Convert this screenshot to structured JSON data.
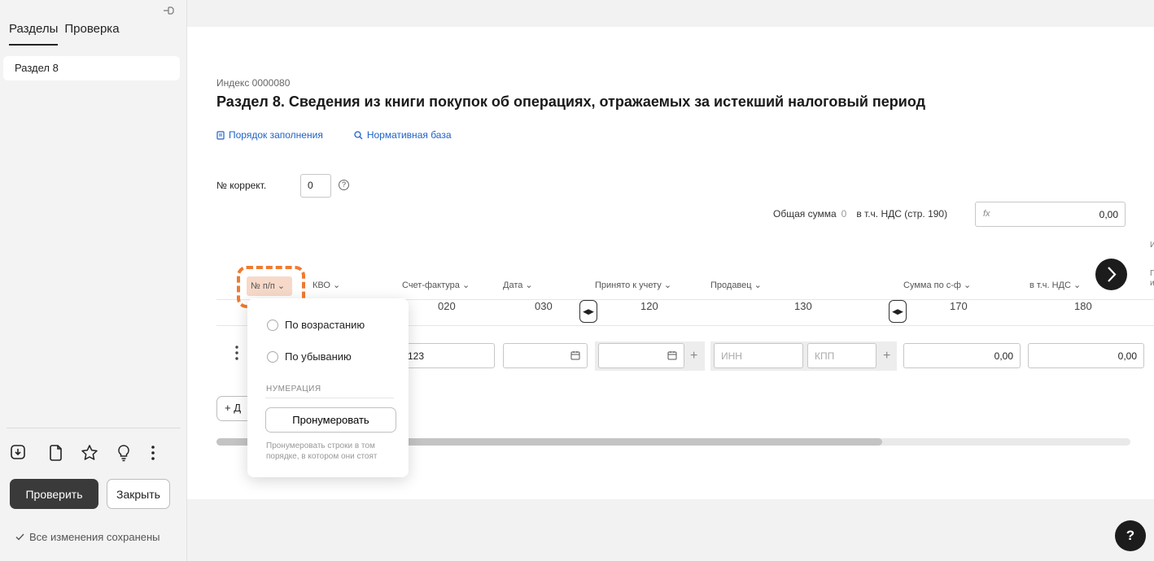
{
  "sidebar": {
    "tabs": [
      "Разделы",
      "Проверка"
    ],
    "items": [
      {
        "label": "Раздел 8"
      }
    ],
    "check_label": "Проверить",
    "close_label": "Закрыть",
    "saved_text": "Все изменения сохранены"
  },
  "header": {
    "index": "Индекс 0000080",
    "title": "Раздел 8. Сведения из книги покупок об операциях, отражаемых за истекший налоговый период",
    "link_order": "Порядок заполнения",
    "link_base": "Нормативная база"
  },
  "form": {
    "korr_label": "№ коррект.",
    "korr_value": "0",
    "total_label": "Общая сумма",
    "total_count": "0",
    "vat_label": "в т.ч. НДС (стр. 190)",
    "vat_value": "0,00",
    "fx": "fx"
  },
  "table": {
    "headers": {
      "num": "№ п/п ⌄",
      "kvo": "КВО ⌄",
      "invoice": "Счет-фактура ⌄",
      "date": "Дата ⌄",
      "accepted": "Принято к учету ⌄",
      "seller": "Продавец ⌄",
      "sum": "Сумма по с-ф ⌄",
      "vat": "в т.ч. НДС ⌄"
    },
    "codes": [
      "020",
      "030",
      "120",
      "130",
      "170",
      "180"
    ],
    "row": {
      "invoice": "123",
      "inn_placeholder": "ИНН",
      "kpp_placeholder": "КПП",
      "sum": "0,00",
      "vat": "0,00"
    },
    "add_label": "+ Д"
  },
  "popup": {
    "asc": "По возрастанию",
    "desc": "По убыванию",
    "section": "НУМЕРАЦИЯ",
    "number_btn": "Пронумеровать",
    "note": "Пронумеровать строки в том порядке, в котором они стоят"
  },
  "fab": "?"
}
